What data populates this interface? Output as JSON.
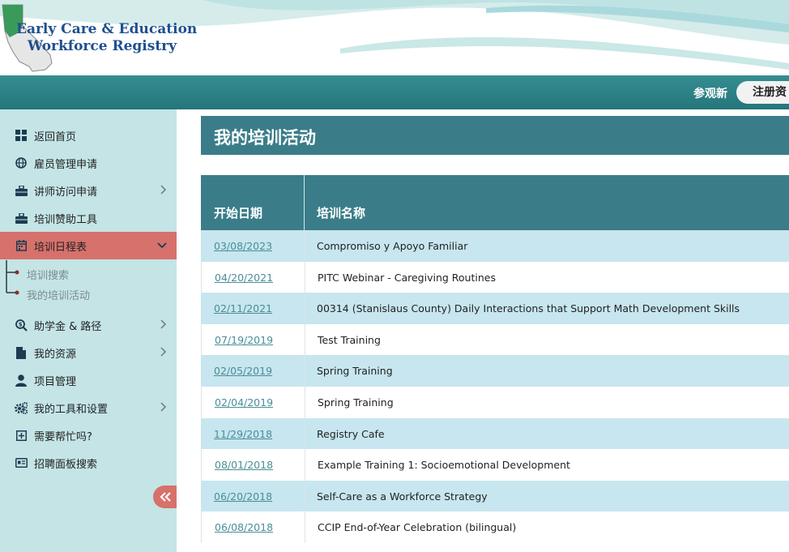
{
  "logo": {
    "line1": "Early Care & Education",
    "line2": "Workforce Registry"
  },
  "topbar": {
    "tour_link": "参观新",
    "register_button": "注册资"
  },
  "sidebar": {
    "items": [
      {
        "label": "返回首页",
        "icon": "dashboard-icon"
      },
      {
        "label": "雇员管理申请",
        "icon": "globe-icon"
      },
      {
        "label": "讲师访问申请",
        "icon": "toolbox-icon",
        "has_chevron": true
      },
      {
        "label": "培训赞助工具",
        "icon": "toolbox-icon"
      },
      {
        "label": "培训日程表",
        "icon": "calendar-icon",
        "active": true,
        "expanded": true
      },
      {
        "label": "助学金 & 路径",
        "icon": "money-search-icon",
        "has_chevron": true
      },
      {
        "label": "我的资源",
        "icon": "file-icon",
        "has_chevron": true
      },
      {
        "label": "项目管理",
        "icon": "user-icon"
      },
      {
        "label": "我的工具和设置",
        "icon": "gears-icon",
        "has_chevron": true
      },
      {
        "label": "需要帮忙吗?",
        "icon": "plus-square-icon"
      },
      {
        "label": "招聘面板搜索",
        "icon": "id-card-icon"
      }
    ],
    "subitems": [
      "培训搜索",
      "我的培训活动"
    ],
    "collapse_icon": "double-chevron-left-icon"
  },
  "main": {
    "title": "我的培训活动",
    "table": {
      "headers": [
        "开始日期",
        "培训名称"
      ],
      "rows": [
        {
          "date": "03/08/2023",
          "name": "Compromiso y Apoyo Familiar"
        },
        {
          "date": "04/20/2021",
          "name": "PITC Webinar - Caregiving Routines"
        },
        {
          "date": "02/11/2021",
          "name": "00314 (Stanislaus County) Daily Interactions that Support Math Development Skills"
        },
        {
          "date": "07/19/2019",
          "name": "Test Training"
        },
        {
          "date": "02/05/2019",
          "name": "Spring Training"
        },
        {
          "date": "02/04/2019",
          "name": "Spring Training"
        },
        {
          "date": "11/29/2018",
          "name": "Registry Cafe"
        },
        {
          "date": "08/01/2018",
          "name": "Example Training 1: Socioemotional Development"
        },
        {
          "date": "06/20/2018",
          "name": "Self-Care as a Workforce Strategy"
        },
        {
          "date": "06/08/2018",
          "name": "CCIP End-of-Year Celebration (bilingual)"
        }
      ]
    }
  },
  "colors": {
    "teal_bar": "#2a7f84",
    "sidebar_bg": "#c4e4e6",
    "active_item": "#d6716b",
    "table_header": "#3a7d89",
    "row_alt": "#c7e6ef",
    "link": "#4a8e98"
  }
}
